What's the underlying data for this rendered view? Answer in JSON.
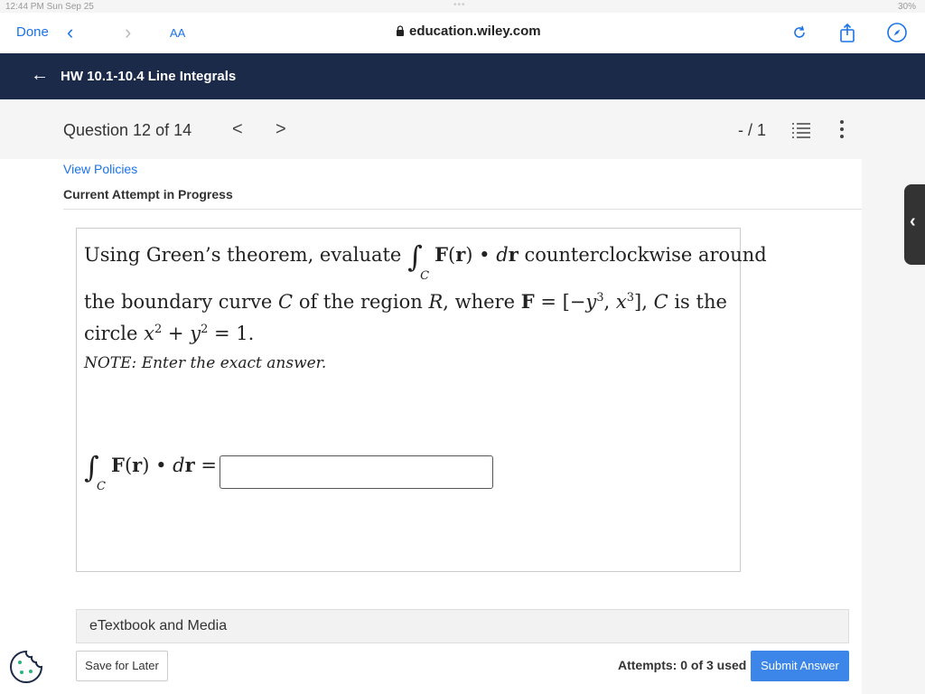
{
  "status_bar": {
    "time_date": "12:44 PM   Sun Sep 25",
    "battery": "30%"
  },
  "browser": {
    "done_label": "Done",
    "text_size_label": "AA",
    "url": "education.wiley.com",
    "icons": [
      "chevron-left-icon",
      "chevron-right-icon",
      "reload-icon",
      "share-icon",
      "compass-icon"
    ]
  },
  "header": {
    "title": "HW 10.1-10.4 Line Integrals"
  },
  "question_bar": {
    "label": "Question 12 of 14",
    "prev": "<",
    "next": ">",
    "score": "- / 1"
  },
  "content": {
    "view_policies": "View Policies",
    "attempt_status": "Current Attempt in Progress"
  },
  "problem": {
    "line1_a": "Using Green’s theorem, evaluate",
    "line1_b": "counterclockwise around",
    "line2_a": "the boundary curve",
    "line2_b": "of the region",
    "line2_c": "where",
    "line2_d": "is the",
    "line3_a": "circle",
    "note": "NOTE: Enter the exact answer."
  },
  "answer": {
    "value": "",
    "placeholder": ""
  },
  "footer": {
    "etextbook": "eTextbook and Media",
    "save_later": "Save for Later",
    "attempts": "Attempts: 0 of 3 used",
    "submit": "Submit Answer"
  },
  "colors": {
    "header_bg": "#1c2a4a",
    "link": "#1a73e8",
    "submit_bg": "#3b86e8"
  }
}
